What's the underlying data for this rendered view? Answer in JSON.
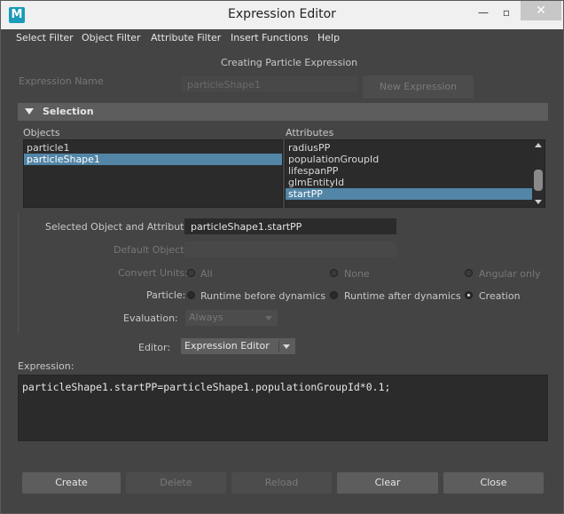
{
  "window": {
    "title": "Expression Editor",
    "app_icon": "M"
  },
  "menu": [
    "Select Filter",
    "Object Filter",
    "Attribute Filter",
    "Insert Functions",
    "Help"
  ],
  "header": {
    "mode_text": "Creating Particle Expression"
  },
  "expression_name": {
    "label": "Expression Name",
    "value": "particleShape1",
    "new_button": "New Expression"
  },
  "selection": {
    "title": "Selection",
    "objects_label": "Objects",
    "attributes_label": "Attributes",
    "objects": [
      "particle1",
      "particleShape1"
    ],
    "objects_selected": 1,
    "attributes": [
      "radiusPP",
      "populationGroupId",
      "lifespanPP",
      "glmEntityId",
      "startPP"
    ],
    "attributes_selected": 4
  },
  "form": {
    "selected_label": "Selected Object and Attribute:",
    "selected_value": "particleShape1.startPP",
    "default_object_label": "Default Object:",
    "convert_units_label": "Convert Units:",
    "convert_units_options": [
      "All",
      "None",
      "Angular only"
    ],
    "particle_label": "Particle:",
    "particle_options": [
      "Runtime before dynamics",
      "Runtime after dynamics",
      "Creation"
    ],
    "particle_selected": 2,
    "evaluation_label": "Evaluation:",
    "evaluation_value": "Always",
    "editor_label": "Editor:",
    "editor_value": "Expression Editor"
  },
  "expression": {
    "label": "Expression:",
    "code": "particleShape1.startPP=particleShape1.populationGroupId*0.1;"
  },
  "buttons": {
    "create": "Create",
    "delete": "Delete",
    "reload": "Reload",
    "clear": "Clear",
    "close": "Close"
  },
  "window_buttons": {
    "minimize": "—",
    "maximize": "▫",
    "close": "✕"
  }
}
